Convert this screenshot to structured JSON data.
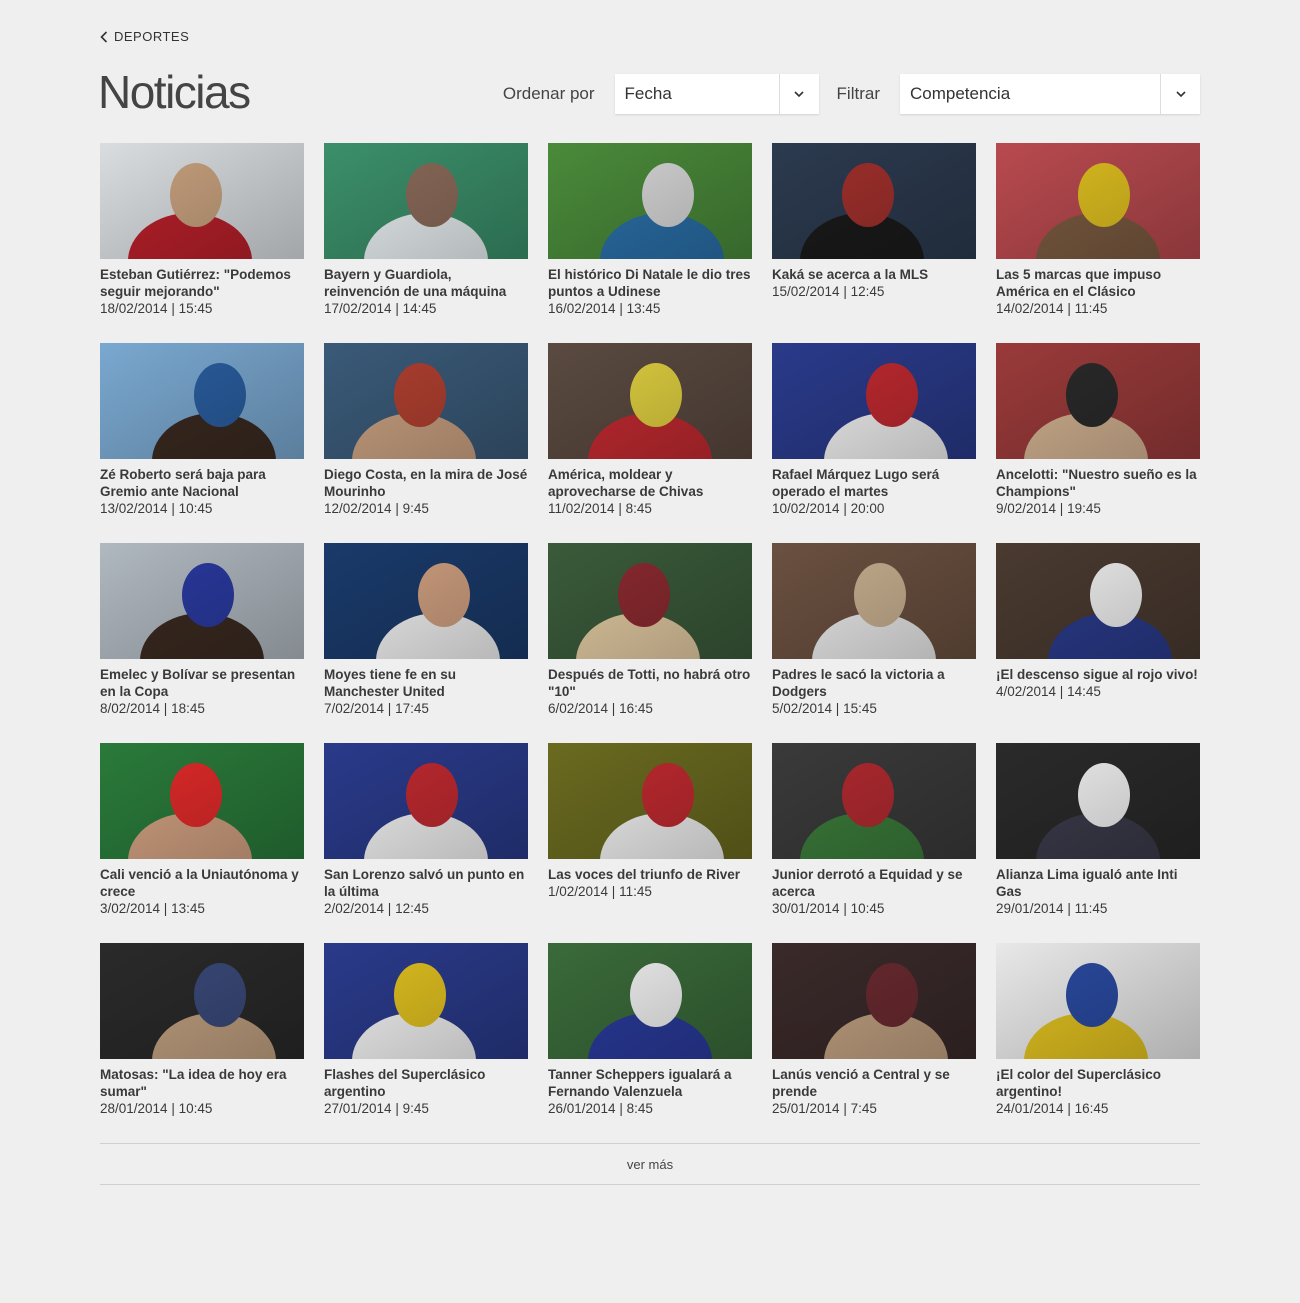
{
  "nav": {
    "back_label": "DEPORTES"
  },
  "page": {
    "title": "Noticias"
  },
  "controls": {
    "sort_label": "Ordenar por",
    "sort_value": "Fecha",
    "filter_label": "Filtrar",
    "filter_value": "Competencia"
  },
  "articles": [
    {
      "title": "Esteban Gutiérrez: \"Podemos seguir mejorando\"",
      "date": "18/02/2014 | 15:45",
      "photo": [
        "#d9dde0",
        "#c9a27f",
        "#b8202a"
      ]
    },
    {
      "title": "Bayern y Guardiola, reinvención de una máquina",
      "date": "17/02/2014 | 14:45",
      "photo": [
        "#3b8f6a",
        "#8c6b5a",
        "#e8eef0"
      ]
    },
    {
      "title": "El histórico Di Natale le dio tres puntos a Udinese",
      "date": "16/02/2014 | 13:45",
      "photo": [
        "#4a8a3a",
        "#d8d8d8",
        "#2a6fa8"
      ]
    },
    {
      "title": "Kaká se acerca a la MLS",
      "date": "15/02/2014 | 12:45",
      "photo": [
        "#2c3a4f",
        "#a0302c",
        "#1a1a1a"
      ]
    },
    {
      "title": "Las 5 marcas que impuso América en el Clásico",
      "date": "14/02/2014 | 11:45",
      "photo": [
        "#b84a4f",
        "#e0c020",
        "#7a5a40"
      ]
    },
    {
      "title": "Zé Roberto será baja para Gremio ante Nacional",
      "date": "13/02/2014 | 10:45",
      "photo": [
        "#7aa8d0",
        "#2a5ea0",
        "#3a2a20"
      ]
    },
    {
      "title": "Diego Costa, en la mira de José Mourinho",
      "date": "12/02/2014 | 9:45",
      "photo": [
        "#3a5a78",
        "#b04030",
        "#c8a080"
      ]
    },
    {
      "title": "América, moldear y aprovecharse de Chivas",
      "date": "11/02/2014 | 8:45",
      "photo": [
        "#5a4a40",
        "#e0d040",
        "#c02a30"
      ]
    },
    {
      "title": "Rafael Márquez Lugo será operado el martes",
      "date": "10/02/2014 | 20:00",
      "photo": [
        "#2a3a8a",
        "#c02a30",
        "#f0f0f0"
      ]
    },
    {
      "title": "Ancelotti: \"Nuestro sueño es la Champions\"",
      "date": "9/02/2014 | 19:45",
      "photo": [
        "#9a3a3a",
        "#2a2a2a",
        "#d0b090"
      ]
    },
    {
      "title": "Emelec y Bolívar se presentan en la Copa",
      "date": "8/02/2014 | 18:45",
      "photo": [
        "#b0b8c0",
        "#2a3aa0",
        "#3a2a20"
      ]
    },
    {
      "title": "Moyes tiene fe en su Manchester United",
      "date": "7/02/2014 | 17:45",
      "photo": [
        "#1a3a6a",
        "#d0a080",
        "#f0f0f0"
      ]
    },
    {
      "title": "Después de Totti, no habrá otro \"10\"",
      "date": "6/02/2014 | 16:45",
      "photo": [
        "#3a5a3a",
        "#8a2a30",
        "#e0c8a0"
      ]
    },
    {
      "title": "Padres le sacó la victoria a Dodgers",
      "date": "5/02/2014 | 15:45",
      "photo": [
        "#6a5040",
        "#c8b090",
        "#e8e8e8"
      ]
    },
    {
      "title": "¡El descenso sigue al rojo vivo!",
      "date": "4/02/2014 | 14:45",
      "photo": [
        "#4a3a30",
        "#f0f0f0",
        "#2a3a8a"
      ]
    },
    {
      "title": "Cali venció a la Uniautónoma y crece",
      "date": "3/02/2014 | 13:45",
      "photo": [
        "#2a7a3a",
        "#e02a2a",
        "#d0a080"
      ]
    },
    {
      "title": "San Lorenzo salvó un punto en la última",
      "date": "2/02/2014 | 12:45",
      "photo": [
        "#2a3a8a",
        "#c02a30",
        "#f0f0f0"
      ]
    },
    {
      "title": "Las voces del triunfo de River",
      "date": "1/02/2014 | 11:45",
      "photo": [
        "#6a6a20",
        "#c02a30",
        "#f0f0f0"
      ]
    },
    {
      "title": "Junior derrotó a Equidad y se acerca",
      "date": "30/01/2014 | 10:45",
      "photo": [
        "#3a3a3a",
        "#b02a30",
        "#3a7a3a"
      ]
    },
    {
      "title": "Alianza Lima igualó ante Inti Gas",
      "date": "29/01/2014 | 11:45",
      "photo": [
        "#2a2a2a",
        "#f0f0f0",
        "#3a3a4a"
      ]
    },
    {
      "title": "Matosas: \"La idea de hoy era sumar\"",
      "date": "28/01/2014 | 10:45",
      "photo": [
        "#2a2a2a",
        "#3a4a7a",
        "#c0a080"
      ]
    },
    {
      "title": "Flashes del Superclásico argentino",
      "date": "27/01/2014 | 9:45",
      "photo": [
        "#2a3a8a",
        "#e0c020",
        "#f0f0f0"
      ]
    },
    {
      "title": "Tanner Scheppers igualará a Fernando Valenzuela",
      "date": "26/01/2014 | 8:45",
      "photo": [
        "#3a6a3a",
        "#f0f0f0",
        "#2a3a9a"
      ]
    },
    {
      "title": "Lanús venció a Central y se prende",
      "date": "25/01/2014 | 7:45",
      "photo": [
        "#3a2a2a",
        "#6a2a30",
        "#c0a080"
      ]
    },
    {
      "title": "¡El color del Superclásico argentino!",
      "date": "24/01/2014 | 16:45",
      "photo": [
        "#e8e8e8",
        "#2a4aa0",
        "#e0c020"
      ]
    }
  ],
  "footer": {
    "more_label": "ver más"
  }
}
